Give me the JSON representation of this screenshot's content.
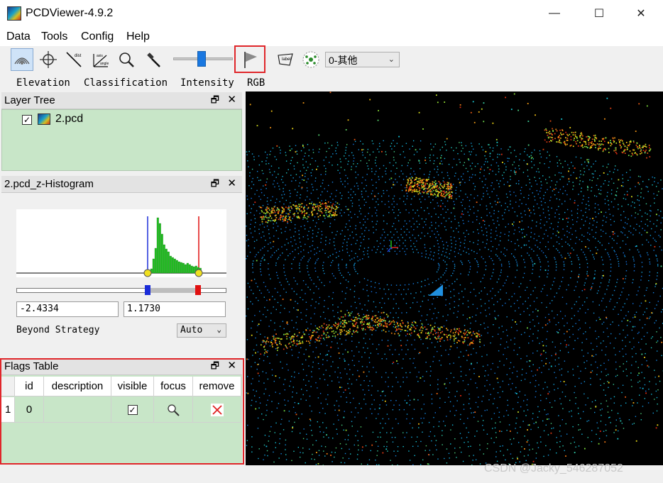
{
  "window": {
    "title": "PCDViewer-4.9.2",
    "minimize": "—",
    "maximize": "☐",
    "close": "✕"
  },
  "menu": [
    "Data",
    "Tools",
    "Config",
    "Help"
  ],
  "toolbar": {
    "icons": [
      "point-cloud-select-icon",
      "crosshair-icon",
      "measure-distance-icon",
      "measure-angle-icon",
      "zoom-icon",
      "hammer-icon",
      "flag-icon",
      "label-icon",
      "cluster-icon"
    ],
    "slider_level": 0.45,
    "class_combo": "0-其他",
    "highlight_color": "#e0262a",
    "active_color": "#1977e0"
  },
  "colorbar": [
    "Elevation",
    "Classification",
    "Intensity",
    "RGB"
  ],
  "layer_tree": {
    "title": "Layer Tree",
    "float": "🗗",
    "close": "✕",
    "items": [
      {
        "checked": "✓",
        "name": "2.pcd"
      }
    ]
  },
  "histogram": {
    "title": "2.pcd_z-Histogram",
    "float": "🗗",
    "close": "✕",
    "min_value": "-2.4334",
    "max_value": "1.1730",
    "beyond_label": "Beyond Strategy",
    "beyond_value": "Auto"
  },
  "flags_table": {
    "title": "Flags Table",
    "float": "🗗",
    "close": "✕",
    "columns": [
      "id",
      "description",
      "visible",
      "focus",
      "remove"
    ],
    "rows": [
      {
        "row_num": "1",
        "id": "0",
        "description": "",
        "visible": "✓",
        "focus": "🔍",
        "remove": "✕"
      }
    ]
  },
  "watermark": "CSDN @Jacky_546287052"
}
